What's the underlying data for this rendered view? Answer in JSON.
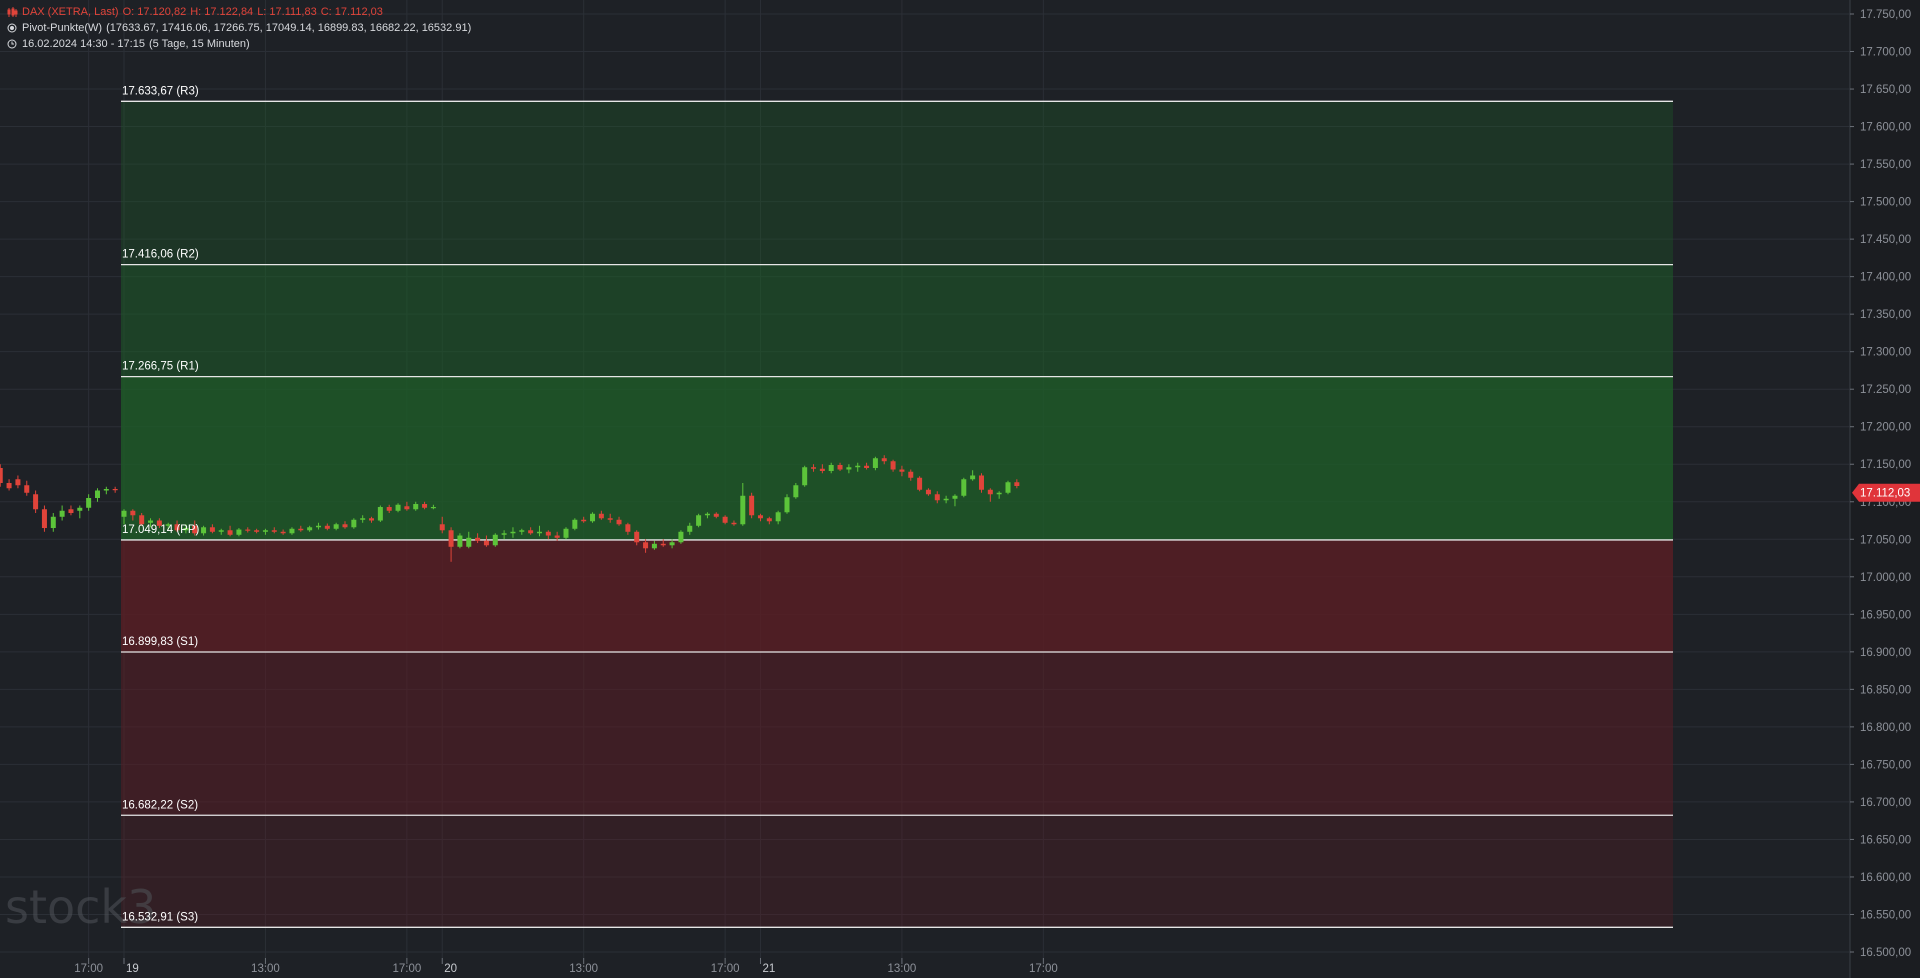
{
  "header": {
    "instrument": "DAX (XETRA, Last)",
    "open": "O: 17.120,82",
    "high": "H: 17.122,84",
    "low": "L: 17.111,83",
    "close": "C: 17.112,03",
    "pivot_indicator": "Pivot-Punkte(W)",
    "pivot_values": "(17633.67,  17416.06,  17266.75,  17049.14,  16899.83,  16682.22,  16532.91)",
    "time_range": "16.02.2024 14:30 - 17:15",
    "time_span": "(5 Tage, 15 Minuten)",
    "icons": {
      "instrument": "candlestick-icon",
      "indicator": "radio-dot-icon",
      "time": "clock-icon"
    }
  },
  "watermark": "stock3",
  "colors": {
    "background": "#1e2126",
    "axis_background": "#1b1d21",
    "grid": "#2b2f36",
    "up_candle": "#5cc43a",
    "down_candle": "#e0443a",
    "resistance_zone": "#1e5c28",
    "support_zone": "#5a1e24",
    "pivot_line": "#e6e6e6",
    "price_tag": "#e0343a"
  },
  "chart_data": {
    "type": "candlestick",
    "title": "DAX (XETRA, Last)",
    "y_axis": {
      "side": "right",
      "ylim": [
        16480,
        17765
      ],
      "ticks": [
        17750,
        17700,
        17650,
        17600,
        17550,
        17500,
        17450,
        17400,
        17350,
        17300,
        17250,
        17200,
        17150,
        17100,
        17050,
        17000,
        16950,
        16900,
        16850,
        16800,
        16750,
        16700,
        16650,
        16600,
        16550,
        16500
      ],
      "tick_labels": [
        "17.750,00",
        "17.700,00",
        "17.650,00",
        "17.600,00",
        "17.550,00",
        "17.500,00",
        "17.450,00",
        "17.400,00",
        "17.350,00",
        "17.300,00",
        "17.250,00",
        "17.200,00",
        "17.150,00",
        "17.100,00",
        "17.050,00",
        "17.000,00",
        "16.950,00",
        "16.900,00",
        "16.850,00",
        "16.800,00",
        "16.750,00",
        "16.700,00",
        "16.650,00",
        "16.600,00",
        "16.550,00",
        "16.500,00"
      ]
    },
    "x_axis": {
      "tick_labels": [
        "17:00",
        "19",
        "13:00",
        "17:00",
        "20",
        "13:00",
        "17:00",
        "21",
        "13:00",
        "17:00"
      ],
      "tick_bar_index": [
        -4,
        0,
        16,
        32,
        36,
        52,
        68,
        72,
        88,
        104
      ]
    },
    "current_price": {
      "value": 17112.03,
      "label": "17.112,03"
    },
    "pivot_levels": [
      {
        "name": "R3",
        "value": 17633.67,
        "label": "17.633,67 (R3)"
      },
      {
        "name": "R2",
        "value": 17416.06,
        "label": "17.416,06 (R2)"
      },
      {
        "name": "R1",
        "value": 17266.75,
        "label": "17.266,75 (R1)"
      },
      {
        "name": "PP",
        "value": 17049.14,
        "label": "17.049,14 (PP)"
      },
      {
        "name": "S1",
        "value": 16899.83,
        "label": "16.899,83 (S1)"
      },
      {
        "name": "S2",
        "value": 16682.22,
        "label": "16.682,22 (S2)"
      },
      {
        "name": "S3",
        "value": 16532.91,
        "label": "16.532,91 (S3)"
      }
    ],
    "pivot_zone_bars": [
      0,
      176
    ],
    "candles": [
      [
        -14,
        17145,
        17150,
        17120,
        17125
      ],
      [
        -13,
        17125,
        17130,
        17115,
        17118
      ],
      [
        -12,
        17130,
        17135,
        17118,
        17122
      ],
      [
        -11,
        17122,
        17128,
        17108,
        17112
      ],
      [
        -10,
        17110,
        17115,
        17085,
        17090
      ],
      [
        -9,
        17090,
        17095,
        17060,
        17065
      ],
      [
        -8,
        17065,
        17085,
        17060,
        17080
      ],
      [
        -7,
        17080,
        17095,
        17075,
        17088
      ],
      [
        -6,
        17090,
        17095,
        17082,
        17085
      ],
      [
        -5,
        17088,
        17095,
        17078,
        17092
      ],
      [
        -4,
        17092,
        17110,
        17088,
        17105
      ],
      [
        -3,
        17105,
        17118,
        17100,
        17115
      ],
      [
        -2,
        17115,
        17120,
        17110,
        17117
      ],
      [
        -1,
        17117,
        17120,
        17112,
        17116
      ],
      [
        0,
        17080,
        17090,
        17070,
        17088
      ],
      [
        1,
        17088,
        17090,
        17075,
        17082
      ],
      [
        2,
        17082,
        17085,
        17068,
        17070
      ],
      [
        3,
        17072,
        17078,
        17066,
        17075
      ],
      [
        4,
        17075,
        17078,
        17065,
        17068
      ],
      [
        5,
        17068,
        17072,
        17062,
        17070
      ],
      [
        6,
        17070,
        17075,
        17060,
        17062
      ],
      [
        7,
        17062,
        17070,
        17058,
        17065
      ],
      [
        8,
        17068,
        17075,
        17055,
        17058
      ],
      [
        9,
        17058,
        17068,
        17055,
        17066
      ],
      [
        10,
        17066,
        17070,
        17058,
        17060
      ],
      [
        11,
        17060,
        17064,
        17056,
        17062
      ],
      [
        12,
        17062,
        17068,
        17054,
        17056
      ],
      [
        13,
        17056,
        17065,
        17054,
        17063
      ],
      [
        14,
        17063,
        17066,
        17059,
        17062
      ],
      [
        15,
        17062,
        17064,
        17058,
        17060
      ],
      [
        16,
        17060,
        17064,
        17056,
        17062
      ],
      [
        17,
        17062,
        17066,
        17058,
        17060
      ],
      [
        18,
        17060,
        17063,
        17056,
        17058
      ],
      [
        19,
        17058,
        17066,
        17056,
        17064
      ],
      [
        20,
        17064,
        17068,
        17060,
        17062
      ],
      [
        21,
        17062,
        17068,
        17060,
        17066
      ],
      [
        22,
        17066,
        17072,
        17063,
        17068
      ],
      [
        23,
        17068,
        17071,
        17062,
        17064
      ],
      [
        24,
        17064,
        17072,
        17062,
        17070
      ],
      [
        25,
        17070,
        17074,
        17064,
        17066
      ],
      [
        26,
        17066,
        17078,
        17064,
        17076
      ],
      [
        27,
        17076,
        17082,
        17072,
        17078
      ],
      [
        28,
        17078,
        17080,
        17072,
        17075
      ],
      [
        29,
        17075,
        17095,
        17073,
        17093
      ],
      [
        30,
        17093,
        17096,
        17085,
        17088
      ],
      [
        31,
        17088,
        17098,
        17086,
        17096
      ],
      [
        32,
        17094,
        17100,
        17088,
        17090
      ],
      [
        33,
        17090,
        17100,
        17088,
        17097
      ],
      [
        34,
        17097,
        17100,
        17090,
        17092
      ],
      [
        35,
        17092,
        17096,
        17090,
        17093
      ],
      [
        36,
        17070,
        17080,
        17058,
        17062
      ],
      [
        37,
        17062,
        17066,
        17020,
        17040
      ],
      [
        38,
        17040,
        17058,
        17038,
        17055
      ],
      [
        39,
        17040,
        17060,
        17038,
        17052
      ],
      [
        40,
        17052,
        17058,
        17045,
        17048
      ],
      [
        41,
        17048,
        17055,
        17040,
        17042
      ],
      [
        42,
        17042,
        17058,
        17040,
        17056
      ],
      [
        43,
        17056,
        17062,
        17050,
        17058
      ],
      [
        44,
        17058,
        17066,
        17052,
        17060
      ],
      [
        45,
        17060,
        17064,
        17056,
        17062
      ],
      [
        46,
        17062,
        17066,
        17056,
        17058
      ],
      [
        47,
        17058,
        17068,
        17054,
        17060
      ],
      [
        48,
        17060,
        17062,
        17050,
        17055
      ],
      [
        49,
        17055,
        17060,
        17048,
        17052
      ],
      [
        50,
        17052,
        17066,
        17050,
        17064
      ],
      [
        51,
        17064,
        17078,
        17062,
        17076
      ],
      [
        52,
        17076,
        17080,
        17072,
        17074
      ],
      [
        53,
        17074,
        17086,
        17072,
        17084
      ],
      [
        54,
        17084,
        17088,
        17076,
        17078
      ],
      [
        55,
        17078,
        17084,
        17072,
        17076
      ],
      [
        56,
        17076,
        17080,
        17068,
        17070
      ],
      [
        57,
        17070,
        17072,
        17056,
        17060
      ],
      [
        58,
        17060,
        17062,
        17042,
        17046
      ],
      [
        59,
        17046,
        17050,
        17032,
        17038
      ],
      [
        60,
        17038,
        17048,
        17036,
        17044
      ],
      [
        61,
        17044,
        17050,
        17040,
        17042
      ],
      [
        62,
        17042,
        17050,
        17038,
        17046
      ],
      [
        63,
        17046,
        17062,
        17044,
        17060
      ],
      [
        64,
        17060,
        17072,
        17056,
        17068
      ],
      [
        65,
        17068,
        17084,
        17066,
        17082
      ],
      [
        66,
        17082,
        17086,
        17078,
        17084
      ],
      [
        67,
        17084,
        17086,
        17078,
        17080
      ],
      [
        68,
        17080,
        17082,
        17070,
        17072
      ],
      [
        69,
        17072,
        17075,
        17068,
        17070
      ],
      [
        70,
        17070,
        17125,
        17068,
        17108
      ],
      [
        71,
        17108,
        17112,
        17078,
        17082
      ],
      [
        72,
        17082,
        17084,
        17074,
        17078
      ],
      [
        73,
        17078,
        17080,
        17070,
        17074
      ],
      [
        74,
        17074,
        17088,
        17070,
        17086
      ],
      [
        75,
        17086,
        17110,
        17084,
        17106
      ],
      [
        76,
        17106,
        17125,
        17104,
        17122
      ],
      [
        77,
        17122,
        17148,
        17120,
        17146
      ],
      [
        78,
        17146,
        17150,
        17140,
        17144
      ],
      [
        79,
        17144,
        17150,
        17138,
        17141
      ],
      [
        80,
        17141,
        17152,
        17138,
        17149
      ],
      [
        81,
        17149,
        17152,
        17141,
        17143
      ],
      [
        82,
        17143,
        17150,
        17138,
        17146
      ],
      [
        83,
        17146,
        17152,
        17140,
        17148
      ],
      [
        84,
        17148,
        17152,
        17143,
        17145
      ],
      [
        85,
        17145,
        17160,
        17142,
        17158
      ],
      [
        86,
        17158,
        17162,
        17150,
        17154
      ],
      [
        87,
        17154,
        17156,
        17140,
        17143
      ],
      [
        88,
        17143,
        17148,
        17134,
        17140
      ],
      [
        89,
        17140,
        17143,
        17128,
        17132
      ],
      [
        90,
        17132,
        17134,
        17114,
        17116
      ],
      [
        91,
        17116,
        17118,
        17108,
        17110
      ],
      [
        92,
        17110,
        17114,
        17098,
        17102
      ],
      [
        93,
        17102,
        17108,
        17098,
        17104
      ],
      [
        94,
        17104,
        17110,
        17094,
        17108
      ],
      [
        95,
        17108,
        17132,
        17106,
        17130
      ],
      [
        96,
        17130,
        17142,
        17128,
        17135
      ],
      [
        97,
        17135,
        17138,
        17112,
        17116
      ],
      [
        98,
        17116,
        17118,
        17100,
        17110
      ],
      [
        99,
        17110,
        17114,
        17104,
        17112
      ],
      [
        100,
        17112,
        17128,
        17110,
        17126
      ],
      [
        101,
        17126,
        17130,
        17118,
        17121
      ]
    ]
  }
}
